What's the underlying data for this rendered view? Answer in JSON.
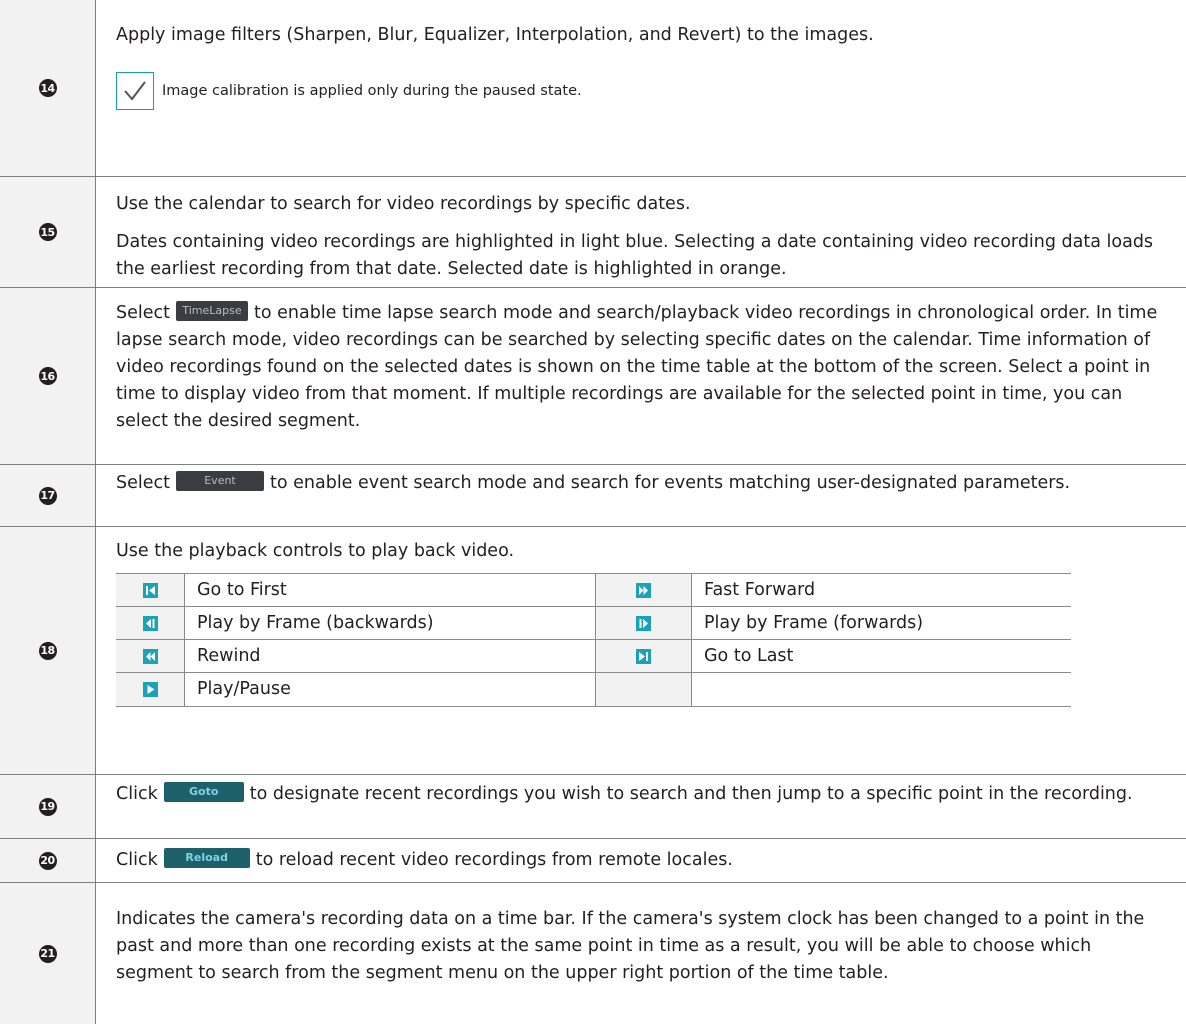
{
  "rows": [
    {
      "number": "14",
      "text": "Apply image filters (Sharpen, Blur, Equalizer, Interpolation, and Revert) to the images.",
      "note": "Image calibration is applied only during the paused state.",
      "note_icon": "checkmark-icon"
    },
    {
      "number": "15",
      "text": "Use the calendar to search for video recordings by specific dates.",
      "text2": "Dates containing video recordings are highlighted in light blue. Selecting a date containing video recording data loads the earliest recording from that date. Selected date is highlighted in orange."
    },
    {
      "number": "16",
      "pre": "Select",
      "button": "TimeLapse",
      "post": "to enable time lapse search mode and search/playback video recordings in chronological order. In time lapse search mode, video recordings can be searched by selecting specific dates on the calendar. Time information of video recordings found on the selected dates is shown on the time table at the bottom of the screen. Select a point in time to display video from that moment. If multiple recordings are available for the selected point in time, you can select the desired segment."
    },
    {
      "number": "17",
      "pre": "Select",
      "button": "Event",
      "post": "to enable event search mode and search for events matching user-designated parameters."
    },
    {
      "number": "18",
      "text": "Use the playback controls to play back video.",
      "controls": [
        {
          "icon": "go-to-first-icon",
          "label": "Go to First",
          "icon2": "fast-forward-icon",
          "label2": "Fast Forward"
        },
        {
          "icon": "play-frame-backward-icon",
          "label": "Play by Frame (backwards)",
          "icon2": "play-frame-forward-icon",
          "label2": "Play by Frame (forwards)"
        },
        {
          "icon": "rewind-icon",
          "label": "Rewind",
          "icon2": "go-to-last-icon",
          "label2": "Go to Last"
        },
        {
          "icon": "play-pause-icon",
          "label": "Play/Pause",
          "icon2": "",
          "label2": ""
        }
      ]
    },
    {
      "number": "19",
      "pre": "Click",
      "button": "Goto",
      "post": "to designate recent recordings you wish to search and then jump to a specific point in the recording."
    },
    {
      "number": "20",
      "pre": "Click",
      "button": "Reload",
      "post": "to reload recent video recordings from remote locales."
    },
    {
      "number": "21",
      "text": "Indicates the camera's recording data on a time bar. If the camera's system clock has been changed to a point in the past and more than one recording exists at the same point in time as a result, you will be able to choose which segment to search from the segment menu on the upper right portion of the time table."
    }
  ],
  "colors": {
    "number_bg": "#f2f2f2",
    "border": "#7f7f7f",
    "note_icon": "#1a9bb5",
    "control_icon": "#1aa2b9",
    "button_dark": "#3a3c41",
    "button_teal": "#1e5f6c"
  }
}
